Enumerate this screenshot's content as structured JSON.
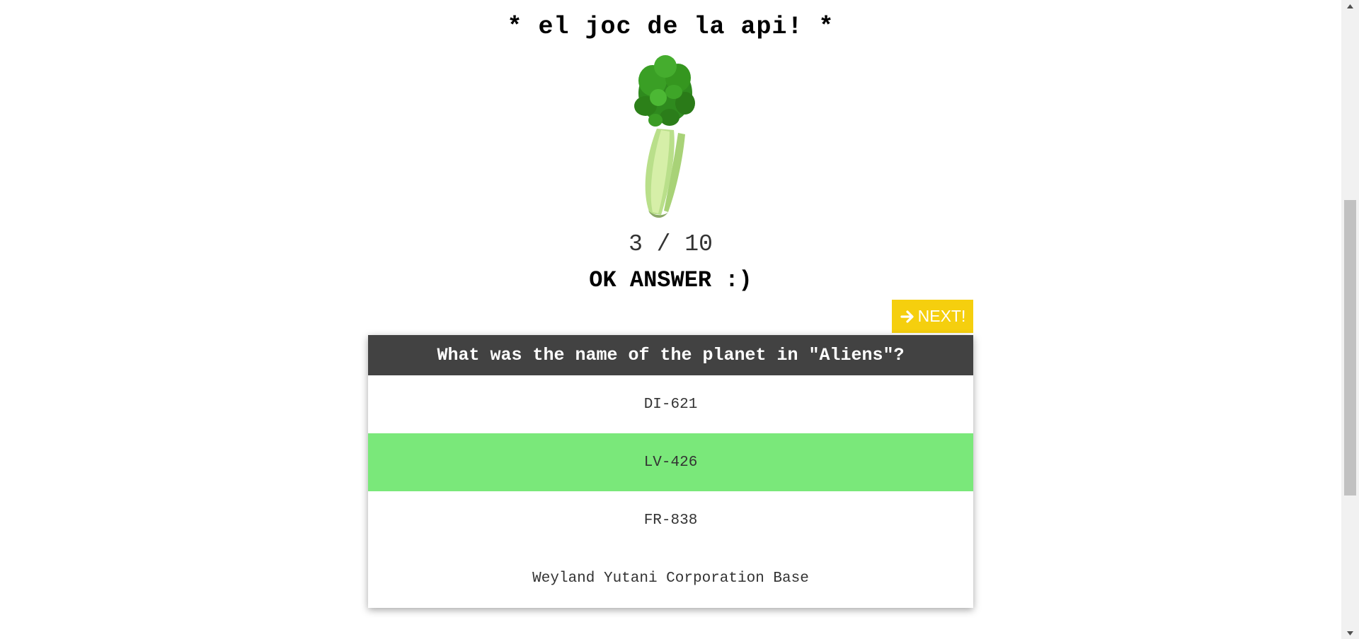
{
  "header": {
    "title": "* el joc de la api! *"
  },
  "image": {
    "icon": "celery-image"
  },
  "progress": {
    "text": "3 / 10",
    "current": 3,
    "total": 10
  },
  "feedback": {
    "text": "OK ANSWER :)"
  },
  "next_button": {
    "label": "NEXT!",
    "icon": "arrow-right-icon",
    "color": "#f5cf0e"
  },
  "quiz": {
    "question": "What was the name of the planet in \"Aliens\"?",
    "answers": [
      {
        "label": "DI-621",
        "correct": false
      },
      {
        "label": "LV-426",
        "correct": true
      },
      {
        "label": "FR-838",
        "correct": false
      },
      {
        "label": "Weyland Yutani Corporation Base",
        "correct": false
      }
    ],
    "header_color": "#424242",
    "correct_color": "#7ae87a"
  }
}
